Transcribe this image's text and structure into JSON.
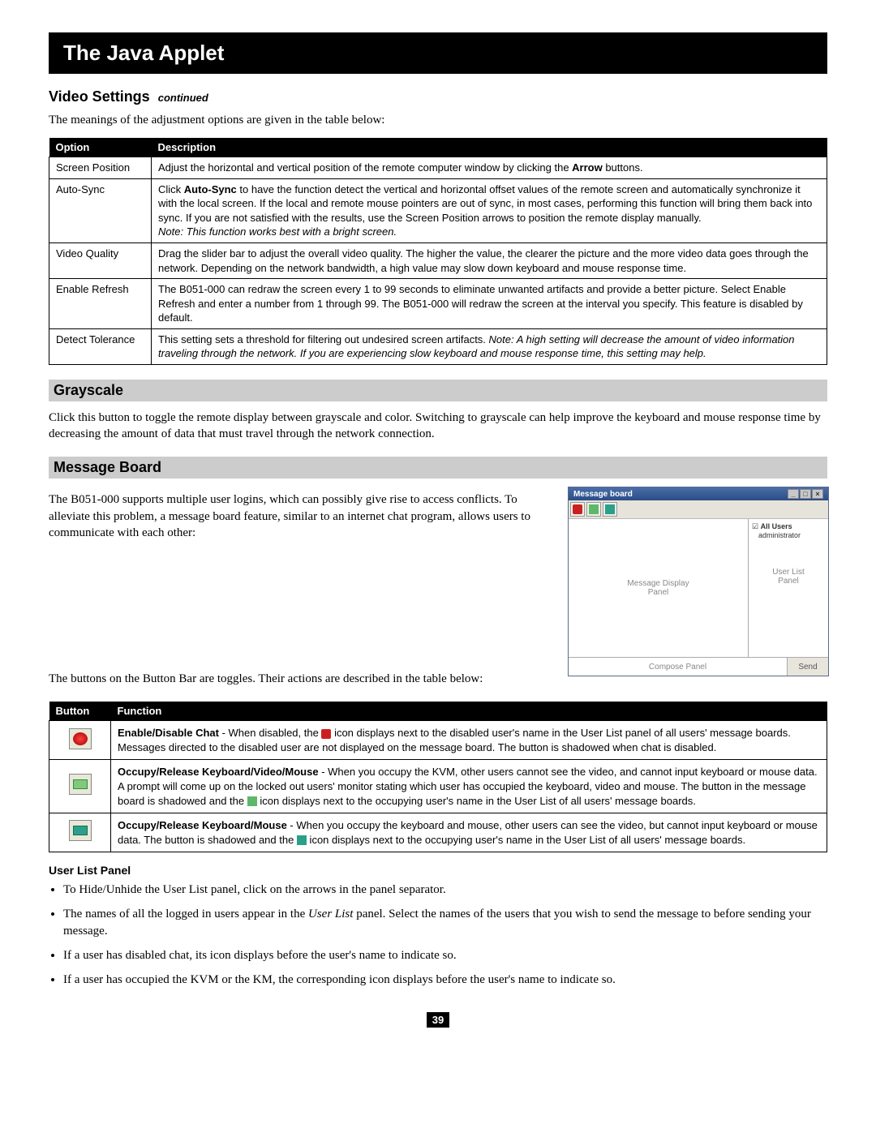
{
  "page_title": "The Java Applet",
  "section_video": {
    "heading": "Video Settings",
    "cont": "continued",
    "intro": "The meanings of the adjustment options are given in the table below:",
    "th_option": "Option",
    "th_desc": "Description",
    "rows": {
      "screen_position": {
        "opt": "Screen Position",
        "desc_a": "Adjust the horizontal and vertical position of the remote computer window by clicking the ",
        "desc_b": "Arrow",
        "desc_c": " buttons."
      },
      "auto_sync": {
        "opt": "Auto-Sync",
        "a": "Click ",
        "b": "Auto-Sync",
        "c": " to have the function detect the vertical and horizontal offset values of the remote screen and automatically synchronize it with the local screen. If the local and remote mouse pointers are out of sync, in most cases, performing this function will bring them back into sync. If you are not satisfied with the results, use the Screen Position arrows to position the remote display manually.",
        "note": "Note: This function works best with a bright screen."
      },
      "video_quality": {
        "opt": "Video Quality",
        "desc": "Drag the slider bar to adjust the overall video quality. The higher the value, the clearer the picture and the more video data goes through the network. Depending on the network bandwidth, a high value may slow down keyboard and mouse response time."
      },
      "enable_refresh": {
        "opt": "Enable Refresh",
        "desc": "The B051-000 can redraw the screen every 1 to 99 seconds to eliminate unwanted artifacts and provide a better picture. Select Enable Refresh and enter a number from 1 through 99. The B051-000 will redraw the screen at the interval you specify. This feature is disabled by default."
      },
      "detect_tol": {
        "opt": "Detect Tolerance",
        "a": "This setting sets a threshold for filtering out undesired screen artifacts. ",
        "note": "Note: A high setting will decrease the amount of video information traveling through the network. If you are experiencing slow keyboard and mouse response time, this setting may help."
      }
    }
  },
  "grayscale": {
    "heading": "Grayscale",
    "body": "Click this button to toggle the remote display between grayscale and color. Switching to grayscale can help improve the keyboard and mouse response time by decreasing the amount of data that must travel through the network connection."
  },
  "msgboard": {
    "heading": "Message Board",
    "p1": "The B051-000 supports multiple user logins, which can possibly give rise to access conflicts. To alleviate this problem, a message board feature, similar to an internet chat program, allows users to communicate with each other:",
    "p2": "The buttons on the Button Bar are toggles. Their actions are described in the table below:",
    "window": {
      "title": "Message board",
      "all_users": "All Users",
      "admin": "administrator",
      "msgpanel": "Message Display\nPanel",
      "userpanel": "User List\nPanel",
      "compose": "Compose Panel",
      "send": "Send"
    },
    "th_button": "Button",
    "th_function": "Function",
    "rows": {
      "chat": {
        "b1": "Enable/Disable Chat",
        "a": " - When disabled, the ",
        "b": " icon displays next to the disabled user's name in the User List panel of all users' message boards. Messages directed to the disabled user are not displayed on the message board. The button is shadowed when chat is disabled."
      },
      "kvm": {
        "b1": "Occupy/Release Keyboard/Video/Mouse",
        "a": " - When you occupy the KVM, other users cannot see the video, and cannot input keyboard or mouse data. A prompt will come up on the locked out users' monitor stating which user has occupied the keyboard, video and mouse. The button in the message board is shadowed and the ",
        "b": " icon displays next to the occupying user's name in the User List of all users' message boards."
      },
      "km": {
        "b1": "Occupy/Release Keyboard/Mouse",
        "a": " - When you occupy the keyboard and mouse, other users can see the video, but cannot input keyboard or mouse data. The button is shadowed and the ",
        "b": " icon displays next to the occupying user's name in the User List of all users' message boards."
      }
    }
  },
  "userlist": {
    "heading": "User List Panel",
    "li1": "To Hide/Unhide the User List panel, click on the arrows in the panel separator.",
    "li2a": "The names of all the logged in users appear in the ",
    "li2b": "User List",
    "li2c": " panel. Select the names of the users that you wish to send the message to before sending your message.",
    "li3": "If a user has disabled chat, its icon displays before the user's name to indicate so.",
    "li4": "If a user has occupied the KVM or the KM, the corresponding icon displays before the user's name to indicate so."
  },
  "page_number": "39"
}
